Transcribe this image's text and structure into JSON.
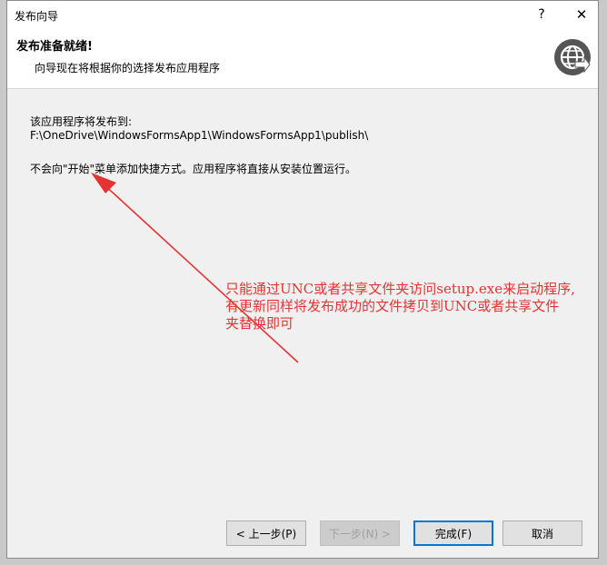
{
  "window": {
    "title": "发布向导",
    "help_label": "?",
    "close_label": "✕"
  },
  "header": {
    "title": "发布准备就绪!",
    "subtitle": "向导现在将根据你的选择发布应用程序",
    "icon": "globe-publish-icon"
  },
  "content": {
    "publish_label": "该应用程序将发布到:",
    "publish_path": "F:\\OneDrive\\WindowsFormsApp1\\WindowsFormsApp1\\publish\\",
    "shortcut_note": "不会向\"开始\"菜单添加快捷方式。应用程序将直接从安装位置运行。"
  },
  "annotation": {
    "line1": "只能通过UNC或者共享文件夹访问setup.exe来启动程序,",
    "line2": "有更新同样将发布成功的文件拷贝到UNC或者共享文件",
    "line3": "夹替换即可",
    "color": "#e53333"
  },
  "buttons": {
    "back": "< 上一步(P)",
    "next": "下一步(N) >",
    "finish": "完成(F)",
    "cancel": "取消"
  }
}
